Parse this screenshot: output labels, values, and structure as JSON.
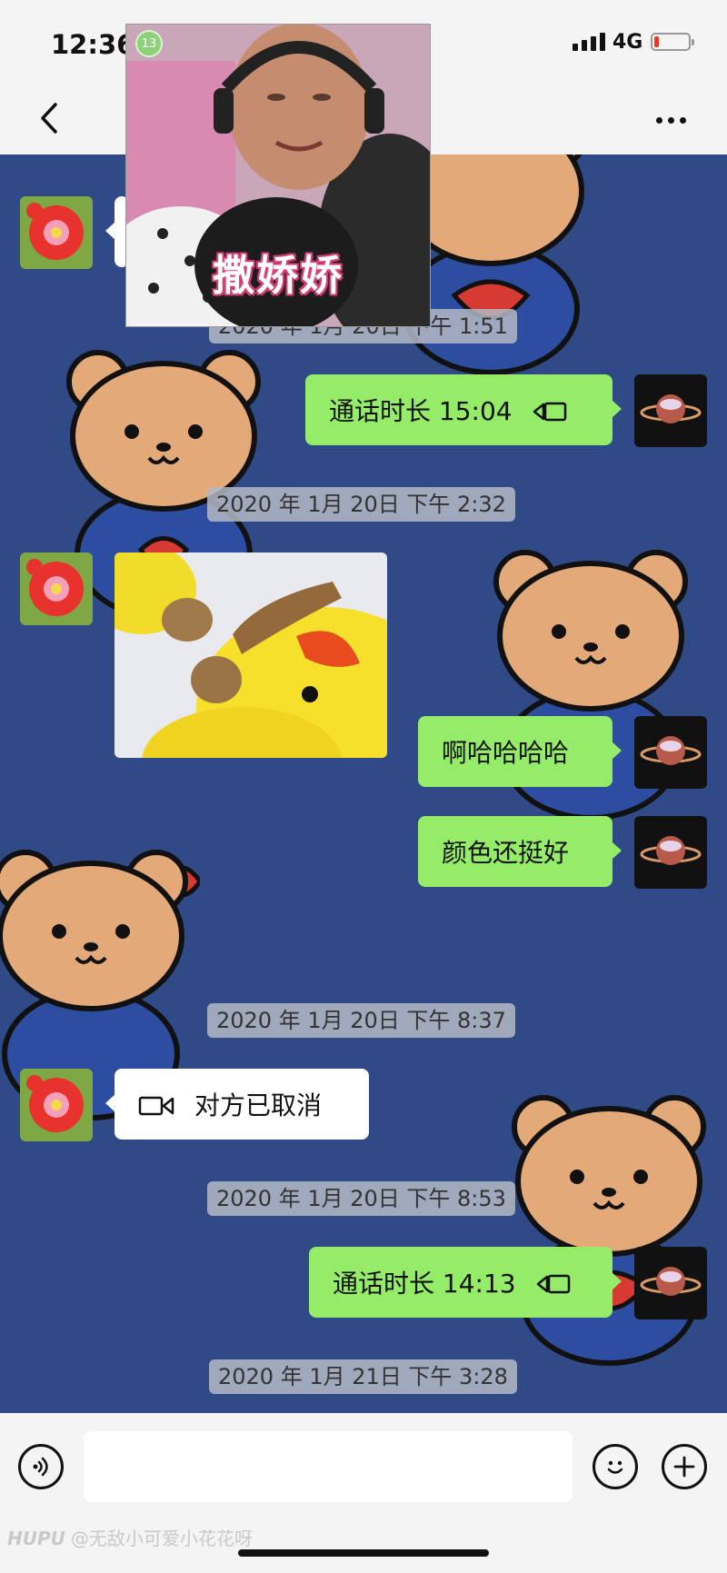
{
  "status": {
    "time": "12:36",
    "network": "4G"
  },
  "pip": {
    "caption": "撒娇娇",
    "badge": "13"
  },
  "messages": [
    {
      "id": "ts1",
      "text": "2020 年 1月 20日 下午 1:51"
    },
    {
      "id": "call1",
      "text": "通话时长 15:04"
    },
    {
      "id": "ts2",
      "text": "2020 年 1月 20日 下午 2:32"
    },
    {
      "id": "m1",
      "text": "啊哈哈哈哈"
    },
    {
      "id": "m2",
      "text": "颜色还挺好"
    },
    {
      "id": "ts3",
      "text": "2020 年 1月 20日 下午 8:37"
    },
    {
      "id": "call2",
      "text": "对方已取消"
    },
    {
      "id": "ts4",
      "text": "2020 年 1月 20日 下午 8:53"
    },
    {
      "id": "call3",
      "text": "通话时长 14:13"
    },
    {
      "id": "ts5",
      "text": "2020 年 1月 21日 下午 3:28"
    }
  ],
  "input": {
    "placeholder": ""
  },
  "watermark": {
    "brand": "HUPU",
    "user": "@无敌小可爱小花花呀"
  },
  "colors": {
    "outgoing_bubble": "#95ec69",
    "incoming_bubble": "#ffffff",
    "wallpaper": "#2f4a86",
    "bars": "#f4f4f5"
  }
}
